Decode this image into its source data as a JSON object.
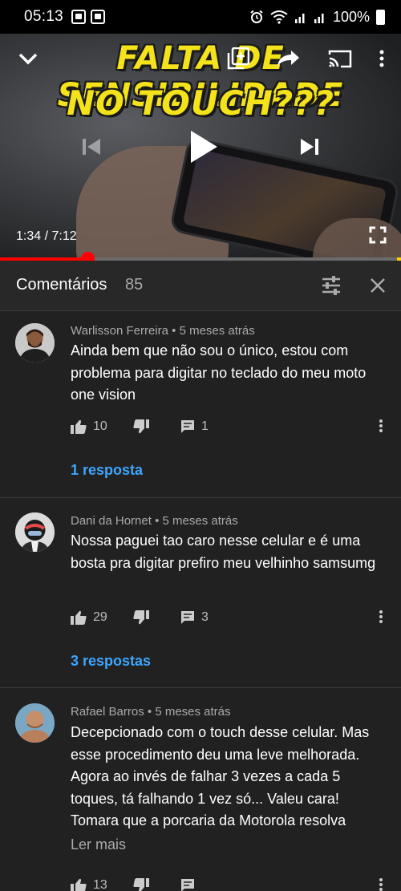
{
  "status_bar": {
    "time": "05:13",
    "battery": "100%"
  },
  "video": {
    "title_line_1": "FALTA DE SENSIBILIDADE",
    "title_line_2": "NO TOUCH???",
    "time_readout": "1:34 / 7:12",
    "progress_fraction": 0.217
  },
  "comments_header": {
    "title": "Comentários",
    "count": "85"
  },
  "comments": [
    {
      "author": "Warlisson Ferreira",
      "age": "5 meses atrás",
      "text": "Ainda bem que não sou o único, estou com problema para digitar no teclado do meu moto one vision",
      "likes": "10",
      "replies_count": "1",
      "replies_link": "1 resposta"
    },
    {
      "author": "Dani da Hornet",
      "age": "5 meses atrás",
      "text": "Nossa paguei tao caro nesse celular e é uma bosta pra digitar prefiro meu velhinho samsumg",
      "likes": "29",
      "replies_count": "3",
      "replies_link": "3 respostas"
    },
    {
      "author": "Rafael Barros",
      "age": "5 meses atrás",
      "text": "Decepcionado com o touch desse celular. Mas esse procedimento deu uma leve melhorada. Agora ao invés de falhar 3 vezes a cada 5 toques, tá falhando 1 vez só... Valeu cara! Tomara que a porcaria da Motorola resolva",
      "read_more": "Ler mais",
      "likes": "13"
    }
  ],
  "colors": {
    "background": "#212121",
    "link": "#3ea6ff",
    "progress": "#ff0000"
  }
}
